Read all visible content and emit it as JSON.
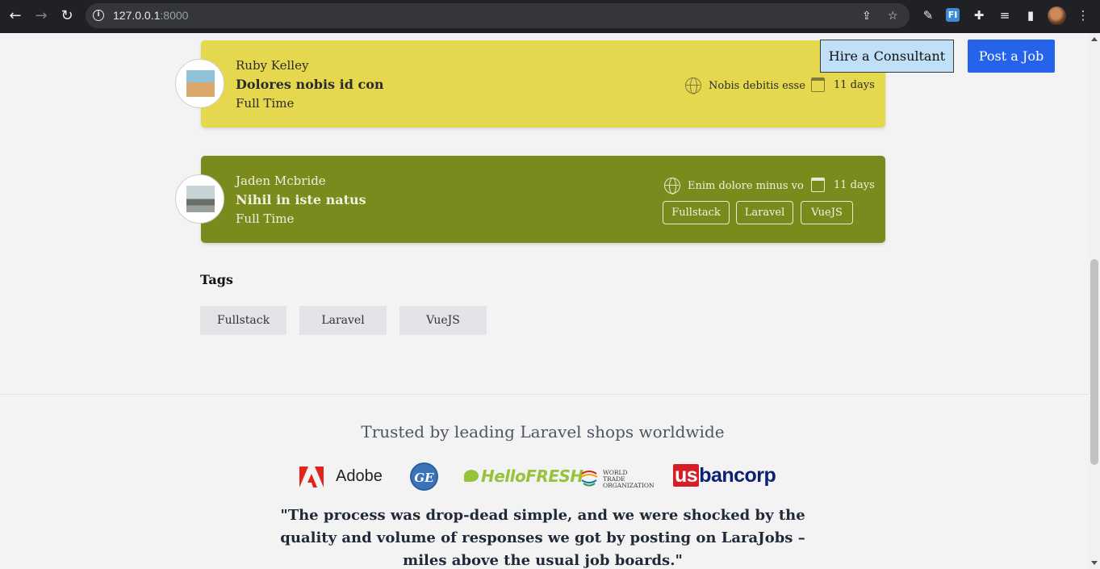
{
  "browser": {
    "url_host": "127.0.0.1",
    "url_port": ":8000"
  },
  "header": {
    "hire_label": "Hire a Consultant",
    "post_label": "Post a Job"
  },
  "jobs": [
    {
      "company": "Ruby Kelley",
      "title": "Dolores nobis id con",
      "type": "Full Time",
      "location": "Nobis debitis esse",
      "posted": "11 days",
      "tags": [],
      "bg_color": "#e5d84f"
    },
    {
      "company": "Jaden Mcbride",
      "title": "Nihil in iste natus",
      "type": "Full Time",
      "location": "Enim dolore minus vo",
      "posted": "11 days",
      "tags": [
        "Fullstack",
        "Laravel",
        "VueJS"
      ],
      "bg_color": "#7a8a1c"
    }
  ],
  "tags_section": {
    "heading": "Tags",
    "tags": [
      "Fullstack",
      "Laravel",
      "VueJS"
    ]
  },
  "trusted": {
    "heading": "Trusted by leading Laravel shops worldwide",
    "brands": {
      "adobe": "Adobe",
      "ge": "GE",
      "hellofresh": "HelloFRESH",
      "wto": "WORLD TRADE ORGANIZATION",
      "usbancorp_us": "us",
      "usbancorp_rest": "bancorp"
    }
  },
  "testimonial": {
    "quote": "\"The process was drop-dead simple, and we were shocked by the quality and volume of responses we got by posting on LaraJobs – miles above the usual job boards.\""
  },
  "colors": {
    "primary": "#2563eb",
    "consult_bg": "#bfe0f7"
  }
}
